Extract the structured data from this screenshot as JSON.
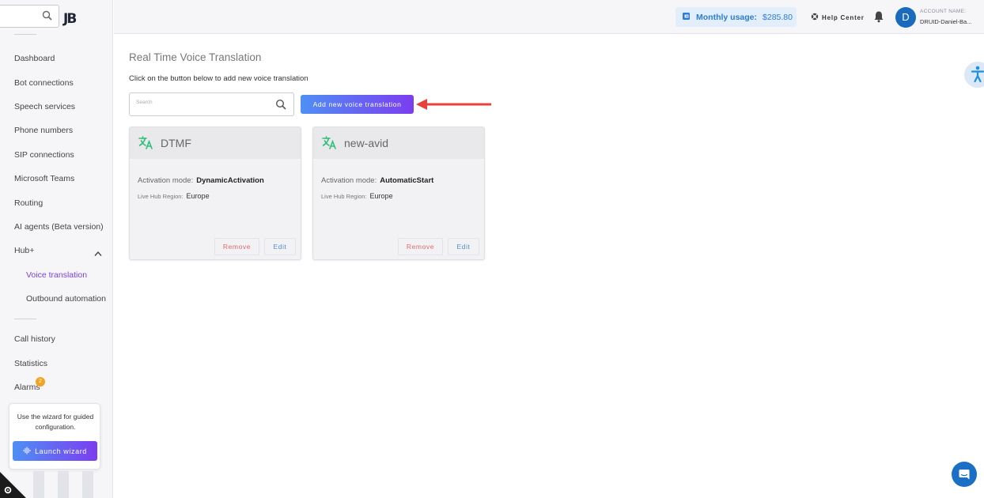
{
  "sidebar": {
    "logo": "JB",
    "items": [
      {
        "label": "Dashboard"
      },
      {
        "label": "Bot connections"
      },
      {
        "label": "Speech services"
      },
      {
        "label": "Phone numbers"
      },
      {
        "label": "SIP connections"
      },
      {
        "label": "Microsoft Teams"
      },
      {
        "label": "Routing"
      },
      {
        "label": "AI agents (Beta version)"
      },
      {
        "label": "Hub+"
      },
      {
        "label": "Voice translation"
      },
      {
        "label": "Outbound automation"
      },
      {
        "label": "Call history"
      },
      {
        "label": "Statistics"
      },
      {
        "label": "Alarms"
      }
    ],
    "alarms_badge": "2",
    "wizard": {
      "text": "Use the wizard for guided configuration.",
      "button": "Launch wizard"
    }
  },
  "topbar": {
    "usage_label": "Monthly usage:",
    "usage_value": "$285.80",
    "help": "Help Center",
    "avatar_letter": "D",
    "account_label": "ACCOUNT NAME:",
    "account_name": "DRUID-Daniel-Ba..."
  },
  "main": {
    "title": "Real Time Voice Translation",
    "subtitle": "Click on the button below to add new voice translation",
    "search_placeholder": "Search",
    "add_button": "Add new voice translation",
    "cards": [
      {
        "title": "DTMF",
        "activation_label": "Activation mode:",
        "activation_value": "DynamicActivation",
        "region_label": "Live Hub Region:",
        "region_value": "Europe",
        "remove": "Remove",
        "edit": "Edit"
      },
      {
        "title": "new-avid",
        "activation_label": "Activation mode:",
        "activation_value": "AutomaticStart",
        "region_label": "Live Hub Region:",
        "region_value": "Europe",
        "remove": "Remove",
        "edit": "Edit"
      }
    ]
  },
  "colors": {
    "accent": "#7c3df0",
    "primary_blue": "#4f8ff5",
    "translate_icon": "#2fbf7a",
    "remove_text": "#e56a6a",
    "edit_text": "#4a90d9",
    "arrow": "#e8413c"
  }
}
